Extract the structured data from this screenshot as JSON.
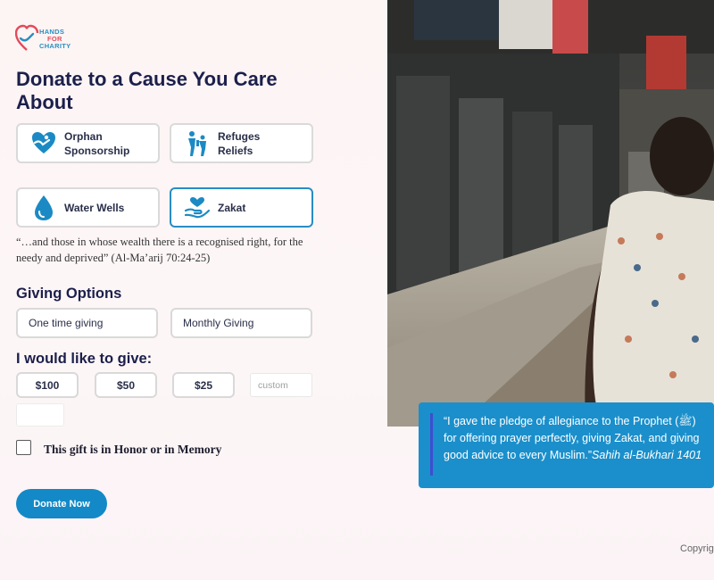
{
  "logo": {
    "line1": "HANDS",
    "line2": "FOR",
    "line3": "CHARITY"
  },
  "heading": "Donate to a Cause You Care About",
  "causes": [
    {
      "label": "Orphan Sponsorship",
      "icon": "orphan-icon",
      "selected": false
    },
    {
      "label": "Refuges Reliefs",
      "icon": "refugees-icon",
      "selected": false
    },
    {
      "label": "Water Wells",
      "icon": "water-drop-icon",
      "selected": false
    },
    {
      "label": "Zakat",
      "icon": "zakat-hand-icon",
      "selected": true
    }
  ],
  "quote": "“…and those in whose wealth there is a recognised right, for the needy and deprived” (Al-Ma’arij 70:24-25)",
  "giving_options": {
    "title": "Giving Options",
    "options": [
      "One time giving",
      "Monthly Giving"
    ]
  },
  "amounts": {
    "title": "I would like to give:",
    "values": [
      "$100",
      "$50",
      "$25"
    ],
    "custom_placeholder": "custom"
  },
  "honor_label": "This gift is in Honor or in Memory",
  "donate_button": "Donate Now",
  "hadith": {
    "text": "“I gave the pledge of allegiance to the Prophet (ﷺ) for offering prayer perfectly, giving Zakat, and giving good advice to every Muslim.”",
    "source": "Sahih al-Bukhari 1401"
  },
  "footer": "Copyrig",
  "colors": {
    "accent": "#1389c7",
    "brand_red": "#e24b5a",
    "heading": "#1b1f4b"
  }
}
